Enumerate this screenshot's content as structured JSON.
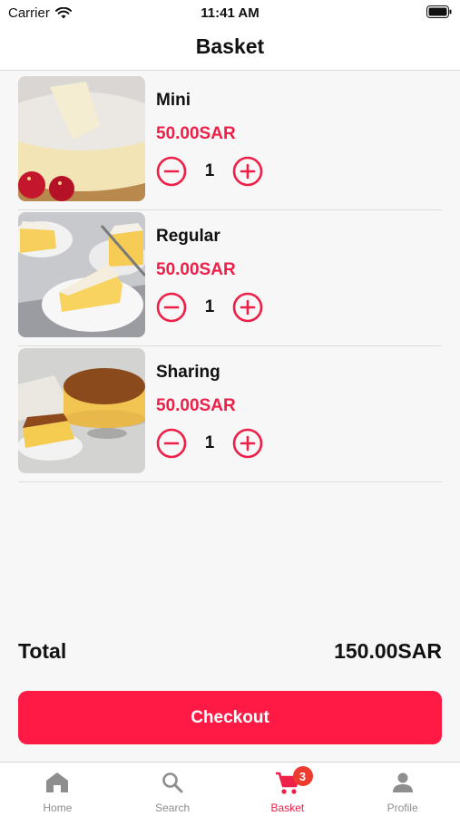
{
  "status_bar": {
    "carrier": "Carrier",
    "time": "11:41 AM"
  },
  "header": {
    "title": "Basket"
  },
  "basket": {
    "items": [
      {
        "name": "Mini",
        "price": "50.00SAR",
        "quantity": "1"
      },
      {
        "name": "Regular",
        "price": "50.00SAR",
        "quantity": "1"
      },
      {
        "name": "Sharing",
        "price": "50.00SAR",
        "quantity": "1"
      }
    ]
  },
  "summary": {
    "total_label": "Total",
    "total_value": "150.00SAR"
  },
  "checkout": {
    "label": "Checkout"
  },
  "tab_bar": {
    "tabs": [
      {
        "label": "Home",
        "icon": "home-icon"
      },
      {
        "label": "Search",
        "icon": "search-icon"
      },
      {
        "label": "Basket",
        "icon": "cart-icon",
        "badge": "3"
      },
      {
        "label": "Profile",
        "icon": "person-icon"
      }
    ],
    "active": "Basket"
  },
  "colors": {
    "accent": "#ee1f48",
    "checkout_bg": "#fe1a44",
    "badge": "#ee3b30",
    "inactive": "#8e8e8e"
  }
}
